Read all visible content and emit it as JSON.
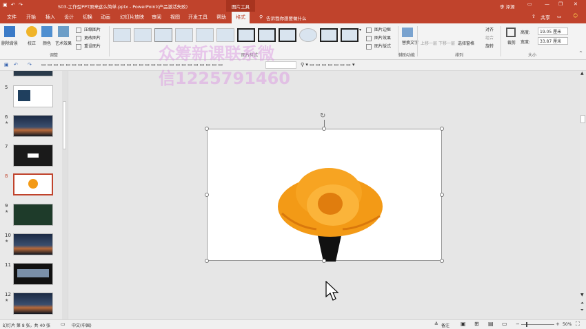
{
  "title": {
    "doc": "S03-工作型PPT原来这么简单.pptx  -  PowerPoint(产品激活失败)",
    "context": "图片工具",
    "user": "李 泽源"
  },
  "tabs": [
    "文件",
    "开始",
    "插入",
    "设计",
    "切换",
    "动画",
    "幻灯片放映",
    "审阅",
    "视图",
    "开发工具",
    "帮助",
    "格式"
  ],
  "tell_me": "告诉我你想要做什么",
  "share": "共享",
  "ribbon": {
    "remove_bg": "删除背景",
    "correct": "校正",
    "color": "颜色",
    "art": "艺术效果",
    "compress": "压缩图片",
    "change": "更改图片",
    "reset": "重设图片",
    "g_adjust": "调整",
    "g_styles": "图片样式",
    "border": "图片边框",
    "effect": "图片效果",
    "layout": "图片版式",
    "alt": "替换文字",
    "g_access": "辅助功能",
    "up": "上移一层",
    "down": "下移一层",
    "pane": "选择窗格",
    "align": "对齐",
    "group": "组合",
    "rotate": "旋转",
    "g_arrange": "排列",
    "crop": "裁剪",
    "h_label": "高度:",
    "h_val": "19.05 厘米",
    "w_label": "宽度:",
    "w_val": "33.87 厘米",
    "g_size": "大小"
  },
  "watermark": {
    "line1": "众筹新课联系微",
    "line2": "信1225791460"
  },
  "slides": [
    {
      "n": "5",
      "star": false
    },
    {
      "n": "6",
      "star": true
    },
    {
      "n": "7",
      "star": false
    },
    {
      "n": "8",
      "star": false
    },
    {
      "n": "9",
      "star": true
    },
    {
      "n": "10",
      "star": true
    },
    {
      "n": "11",
      "star": false
    },
    {
      "n": "12",
      "star": true
    }
  ],
  "status": {
    "slide": "幻灯片 第 8 张，共 40 张",
    "lang": "中文(中国)",
    "notes": "备注",
    "zoom": "50%"
  },
  "colors": {
    "accent": "#c0432c",
    "flower": "#f39a16"
  }
}
